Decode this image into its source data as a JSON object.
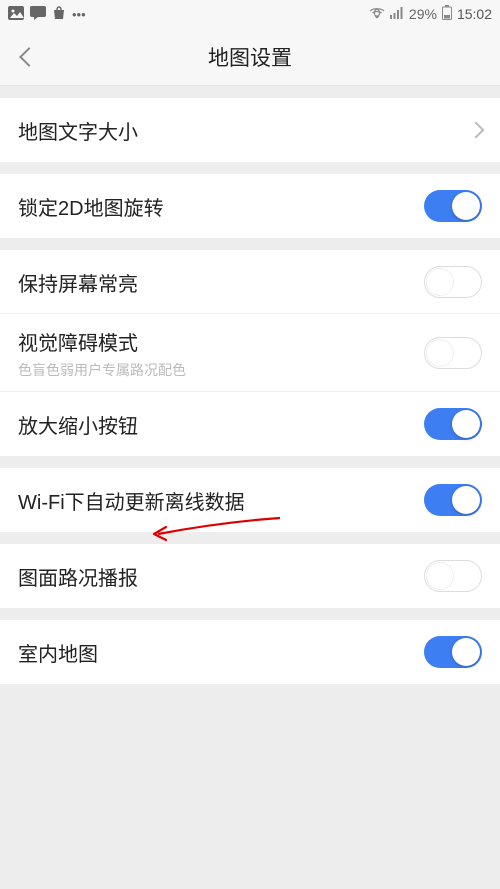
{
  "status_bar": {
    "battery_percent": "29%",
    "time": "15:02"
  },
  "nav": {
    "title": "地图设置"
  },
  "rows": {
    "text_size": {
      "label": "地图文字大小"
    },
    "lock_2d_rotate": {
      "label": "锁定2D地图旋转",
      "on": true
    },
    "keep_screen_on": {
      "label": "保持屏幕常亮",
      "on": false
    },
    "visual_impaired": {
      "label": "视觉障碍模式",
      "sub": "色盲色弱用户专属路况配色",
      "on": false
    },
    "zoom_buttons": {
      "label": "放大缩小按钮",
      "on": true
    },
    "wifi_offline": {
      "label": "Wi-Fi下自动更新离线数据",
      "on": true
    },
    "traffic_broadcast": {
      "label": "图面路况播报",
      "on": false
    },
    "indoor_map": {
      "label": "室内地图",
      "on": true
    }
  }
}
